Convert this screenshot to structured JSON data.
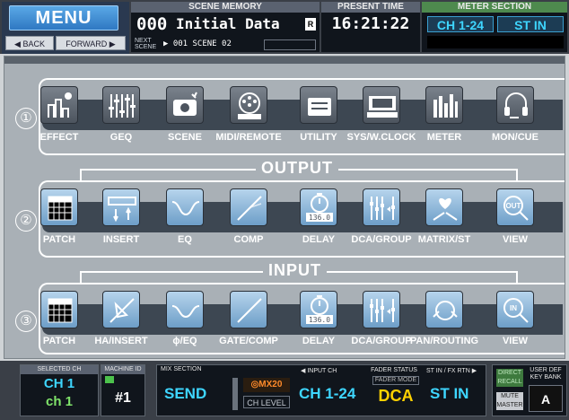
{
  "top": {
    "menu_label": "MENU",
    "back_label": "◀ BACK",
    "forward_label": "FORWARD ▶",
    "scene_memory_header": "SCENE MEMORY",
    "scene_number": "000",
    "scene_title": "Initial Data",
    "scene_flag": "R",
    "next_tag_line1": "NEXT",
    "next_tag_line2": "SCENE",
    "next_scene": "▶ 001 SCENE 02",
    "present_time_header": "PRESENT TIME",
    "present_time": "16:21:22",
    "meter_section_header": "METER SECTION",
    "meter_ch": "CH 1-24",
    "meter_st": "ST IN"
  },
  "groups": [
    {
      "number": "①",
      "title": "",
      "items": [
        {
          "label": "EFFECT",
          "icon": "effect-icon"
        },
        {
          "label": "GEQ",
          "icon": "geq-icon"
        },
        {
          "label": "SCENE",
          "icon": "scene-icon"
        },
        {
          "label": "MIDI/REMOTE",
          "icon": "midi-icon"
        },
        {
          "label": "UTILITY",
          "icon": "utility-icon"
        },
        {
          "label": "SYS/W.CLOCK",
          "icon": "sys-clock-icon"
        },
        {
          "label": "METER",
          "icon": "meter-icon"
        },
        {
          "label": "MON/CUE",
          "icon": "headphones-icon"
        }
      ]
    },
    {
      "number": "②",
      "title": "OUTPUT",
      "items": [
        {
          "label": "PATCH",
          "icon": "patch-icon"
        },
        {
          "label": "INSERT",
          "icon": "insert-icon"
        },
        {
          "label": "EQ",
          "icon": "eq-icon"
        },
        {
          "label": "COMP",
          "icon": "comp-icon"
        },
        {
          "label": "DELAY",
          "icon": "delay-icon",
          "display": "136.0"
        },
        {
          "label": "DCA/GROUP",
          "icon": "dca-group-icon"
        },
        {
          "label": "MATRIX/ST",
          "icon": "matrix-icon"
        },
        {
          "label": "VIEW",
          "icon": "view-out-icon",
          "badge": "OUT"
        }
      ]
    },
    {
      "number": "③",
      "title": "INPUT",
      "items": [
        {
          "label": "PATCH",
          "icon": "patch-icon"
        },
        {
          "label": "HA/INSERT",
          "icon": "ha-insert-icon"
        },
        {
          "label": "ϕ/EQ",
          "icon": "phase-eq-icon"
        },
        {
          "label": "GATE/COMP",
          "icon": "gate-comp-icon"
        },
        {
          "label": "DELAY",
          "icon": "delay-icon",
          "display": "136.0"
        },
        {
          "label": "DCA/GROUP",
          "icon": "dca-group-icon"
        },
        {
          "label": "PAN/ROUTING",
          "icon": "pan-routing-icon"
        },
        {
          "label": "VIEW",
          "icon": "view-in-icon",
          "badge": "IN"
        }
      ]
    }
  ],
  "bottom": {
    "selected_ch_header": "SELECTED CH",
    "selected_ch": "CH 1",
    "selected_ch_name": "ch 1",
    "machine_id_header": "MACHINE ID",
    "machine_id": "#1",
    "mix_section_header": "MIX SECTION",
    "mix_send": "SEND",
    "mix_bus": "MX20",
    "mix_ch_level": "CH LEVEL",
    "input_ch_header": "◀ INPUT CH",
    "input_ch": "CH 1-24",
    "fader_status_header": "FADER STATUS",
    "fader_mode": "FADER MODE",
    "fader_dca": "DCA",
    "stin_header": "ST IN / FX RTN ▶",
    "stin": "ST IN",
    "direct_recall_1": "DIRECT",
    "direct_recall_2": "RECALL",
    "mute_master_1": "MUTE",
    "mute_master_2": "MASTER",
    "user_def_1": "USER DEF",
    "user_def_2": "KEY BANK",
    "user_def_bank": "A"
  },
  "colors": {
    "accent_cyan": "#3ed6ff",
    "dca_yellow": "#ffd200",
    "panel_bg": "#10151c",
    "group_bg": "#3d4752"
  }
}
